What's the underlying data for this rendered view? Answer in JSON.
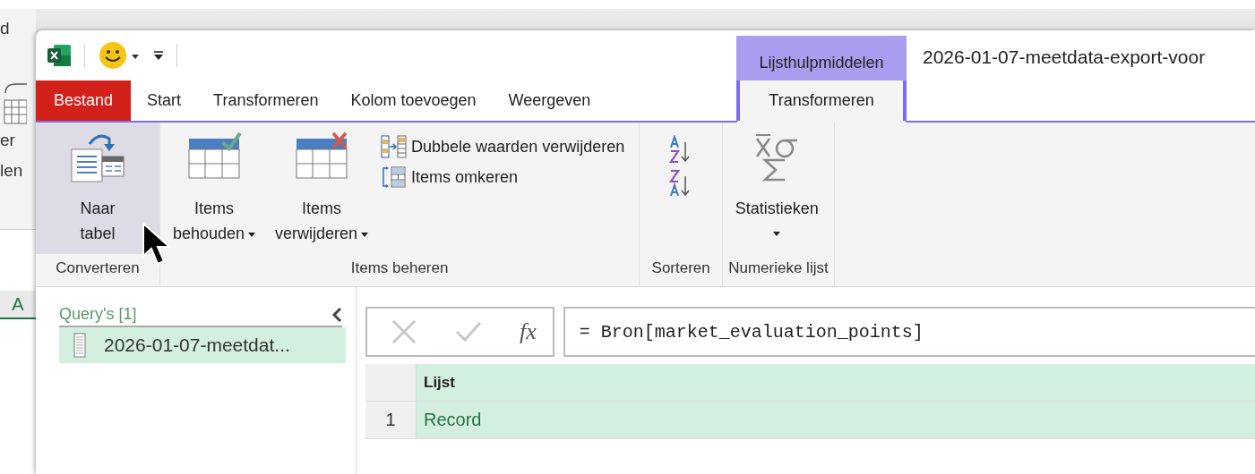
{
  "background_sheet": {
    "top_fragment": "d",
    "ribbon_fragments": [
      "er",
      "len"
    ],
    "column_header": "A"
  },
  "window": {
    "title": "2026-01-07-meetdata-export-voor",
    "contextual_group": "Lijsthulpmiddelen"
  },
  "tabs": [
    {
      "label": "Bestand",
      "kind": "file",
      "selected": false
    },
    {
      "label": "Start",
      "kind": "normal",
      "selected": false
    },
    {
      "label": "Transformeren",
      "kind": "normal",
      "selected": false
    },
    {
      "label": "Kolom toevoegen",
      "kind": "normal",
      "selected": false
    },
    {
      "label": "Weergeven",
      "kind": "normal",
      "selected": false
    },
    {
      "label": "Transformeren",
      "kind": "contextual",
      "selected": true
    }
  ],
  "ribbon": {
    "groups": [
      {
        "label": "Converteren",
        "buttons": [
          {
            "kind": "totable",
            "lines": [
              "Naar",
              "tabel"
            ],
            "highlighted": true
          }
        ]
      },
      {
        "label": "Items beheren",
        "buttons": [
          {
            "kind": "keep",
            "lines": [
              "Items",
              "behouden"
            ],
            "dropdown": true,
            "highlighted": false
          },
          {
            "kind": "remove",
            "lines": [
              "Items",
              "verwijderen"
            ],
            "dropdown": true,
            "highlighted": false
          },
          {
            "kind": "dedupe",
            "lines": [
              "Dubbele waarden verwijderen"
            ],
            "highlighted": false
          },
          {
            "kind": "reverse",
            "lines": [
              "Items omkeren"
            ],
            "highlighted": false
          }
        ]
      },
      {
        "label": "Sorteren",
        "buttons": [
          {
            "kind": "sortasc",
            "highlighted": false
          },
          {
            "kind": "sortdesc",
            "highlighted": false
          }
        ]
      },
      {
        "label": "Numerieke lijst",
        "buttons": [
          {
            "kind": "stats",
            "lines": [
              "Statistieken"
            ],
            "dropdown": true,
            "highlighted": false
          }
        ]
      }
    ]
  },
  "queries": {
    "header": "Query's [1]",
    "items": [
      {
        "label": "2026-01-07-meetdat...",
        "selected": true
      }
    ]
  },
  "formula_bar": {
    "fx": "fx",
    "formula": "= Bron[market_evaluation_points]"
  },
  "grid": {
    "columns": [
      "Lijst"
    ],
    "rows": [
      {
        "number": "1",
        "cells": [
          "Record"
        ]
      }
    ]
  }
}
